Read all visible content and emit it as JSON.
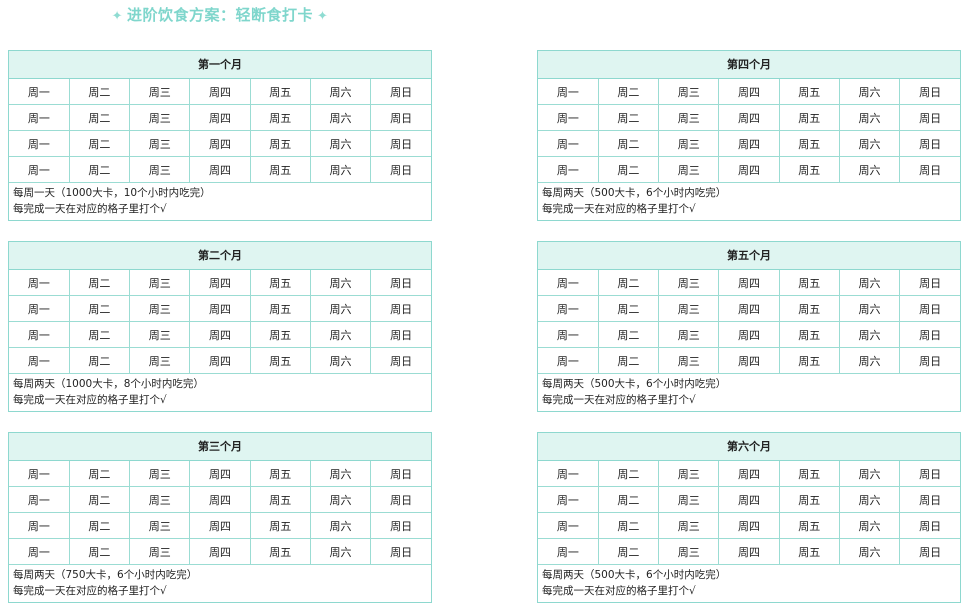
{
  "title": "进阶饮食方案：轻断食打卡",
  "title_star": "✦",
  "colors": {
    "accent": "#7fd6cc",
    "header_bg": "#dff5f1",
    "border": "#8ed8cf"
  },
  "days": [
    "周一",
    "周二",
    "周三",
    "周四",
    "周五",
    "周六",
    "周日"
  ],
  "cards": [
    {
      "header": "第一个月",
      "note1": "每周一天（1000大卡，10个小时内吃完）",
      "note2": "每完成一天在对应的格子里打个√"
    },
    {
      "header": "第二个月",
      "note1": "每周两天（1000大卡，8个小时内吃完）",
      "note2": "每完成一天在对应的格子里打个√"
    },
    {
      "header": "第三个月",
      "note1": "每周两天（750大卡，6个小时内吃完）",
      "note2": "每完成一天在对应的格子里打个√"
    },
    {
      "header": "第四个月",
      "note1": "每周两天（500大卡，6个小时内吃完）",
      "note2": "每完成一天在对应的格子里打个√"
    },
    {
      "header": "第五个月",
      "note1": "每周两天（500大卡，6个小时内吃完）",
      "note2": "每完成一天在对应的格子里打个√"
    },
    {
      "header": "第六个月",
      "note1": "每周两天（500大卡，6个小时内吃完）",
      "note2": "每完成一天在对应的格子里打个√"
    }
  ]
}
